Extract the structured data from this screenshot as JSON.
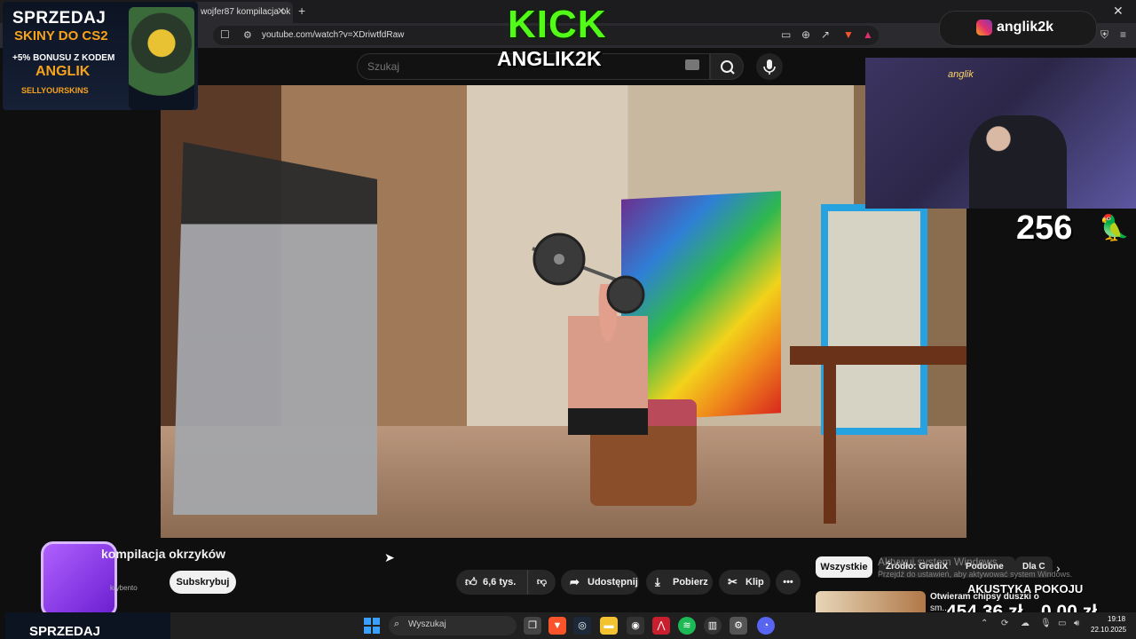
{
  "browser": {
    "tab_title": ") wojfer87 kompilacja ok",
    "tab_close": "✕",
    "new_tab": "+",
    "window_close": "✕",
    "url": "youtube.com/watch?v=XDriwtfdRaw"
  },
  "youtube": {
    "search_placeholder": "Szukaj",
    "video_title": "kompilacja okrzyków",
    "channel_name": "krybento",
    "subscribe": "Subskrybuj",
    "like_count": "6,6 tys.",
    "share": "Udostępnij",
    "download": "Pobierz",
    "clip": "Klip",
    "more": "•••",
    "chips": [
      "Wszystkie",
      "Źródło: GrediX",
      "Podobne",
      "Dla C"
    ],
    "chips_next": "›",
    "recommendation_title_1": "Otwieram chipsy duszki o",
    "recommendation_title_2": "sm..."
  },
  "stream_overlay": {
    "promo_line1": "SPRZEDAJ",
    "promo_line2": "SKINY DO CS2",
    "promo_line3": "+5% BONUSU Z KODEM",
    "promo_code": "ANGLIK",
    "promo_brand": "SELLYOURSKINS",
    "platform": "KICK",
    "streamer": "ANGLIK2K",
    "instagram": "anglik2k",
    "webcam_neon": "anglik",
    "viewer_count": "256",
    "acoustic_label": "AKUSTYKA POKOJU",
    "amount_1": "454,36 zł",
    "amount_2": "0,00 zł",
    "promo_bottom": "SPRZEDAJ"
  },
  "windows": {
    "activate_title": "Aktywuj system Windows",
    "activate_sub": "Przejdź do ustawień, aby aktywować system Windows.",
    "taskbar_search": "Wyszukaj",
    "time": "19:18",
    "date": "22.10.2025"
  },
  "icons": {
    "bookmark": "bookmark-icon",
    "search": "search-icon",
    "mic": "mic-icon",
    "like": "thumbs-up-icon",
    "dislike": "thumbs-down-icon",
    "share": "share-icon",
    "download": "download-icon",
    "clip": "scissors-icon"
  },
  "colors": {
    "kick_green": "#53fc18",
    "promo_orange": "#f7a21b",
    "yt_background": "#0f0f0f"
  }
}
